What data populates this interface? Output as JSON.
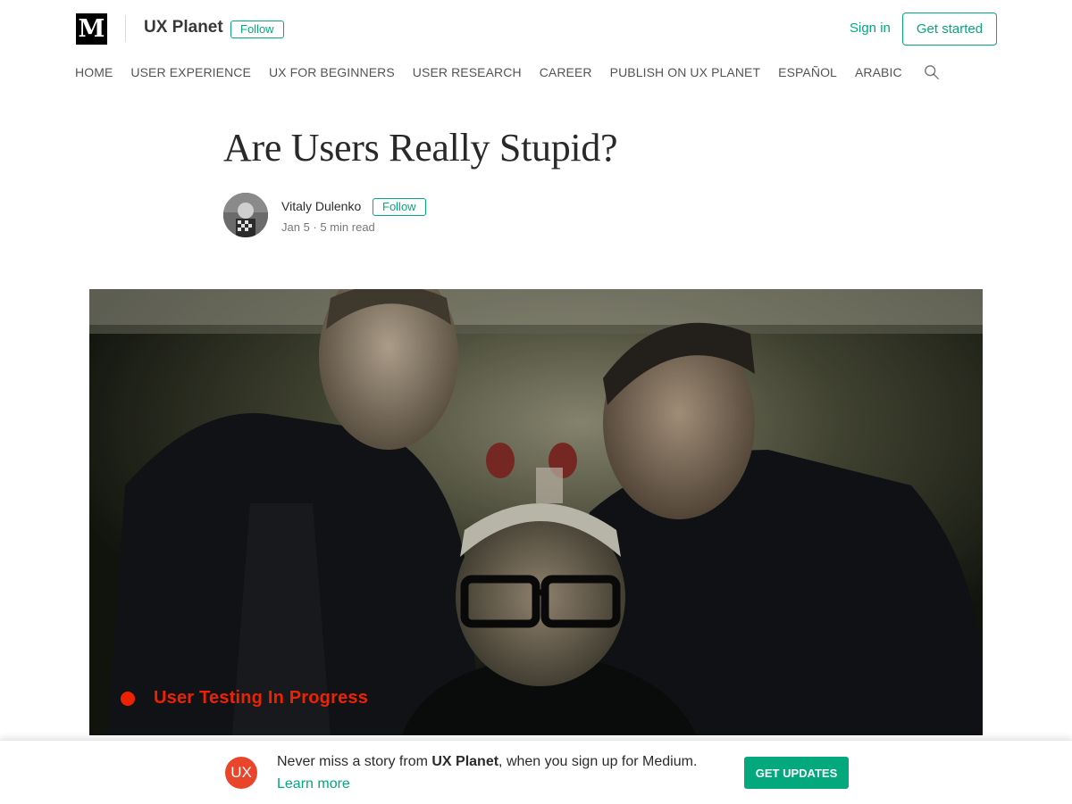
{
  "header": {
    "logo_letter": "M",
    "publication_name": "UX Planet",
    "follow_label": "Follow",
    "sign_in_label": "Sign in",
    "get_started_label": "Get started"
  },
  "nav": {
    "items": [
      "HOME",
      "USER EXPERIENCE",
      "UX FOR BEGINNERS",
      "USER RESEARCH",
      "CAREER",
      "PUBLISH ON UX PLANET",
      "ESPAÑOL",
      "ARABIC"
    ],
    "search_icon": "search-icon"
  },
  "article": {
    "title": "Are Users Really Stupid?",
    "author": "Vitaly Dulenko",
    "follow_label": "Follow",
    "meta": "Jan 5 · 5 min read",
    "hero": {
      "overlay_text": "User Testing In Progress",
      "overlay_color": "#ee2200"
    }
  },
  "banner": {
    "badge_text": "UX",
    "text_before": "Never miss a story from ",
    "publication": "UX Planet",
    "text_after": ", when you sign up for Medium.",
    "learn_more_label": "Learn more",
    "cta_label": "GET UPDATES"
  },
  "colors": {
    "accent": "#03a87c",
    "badge": "#e8452a"
  }
}
